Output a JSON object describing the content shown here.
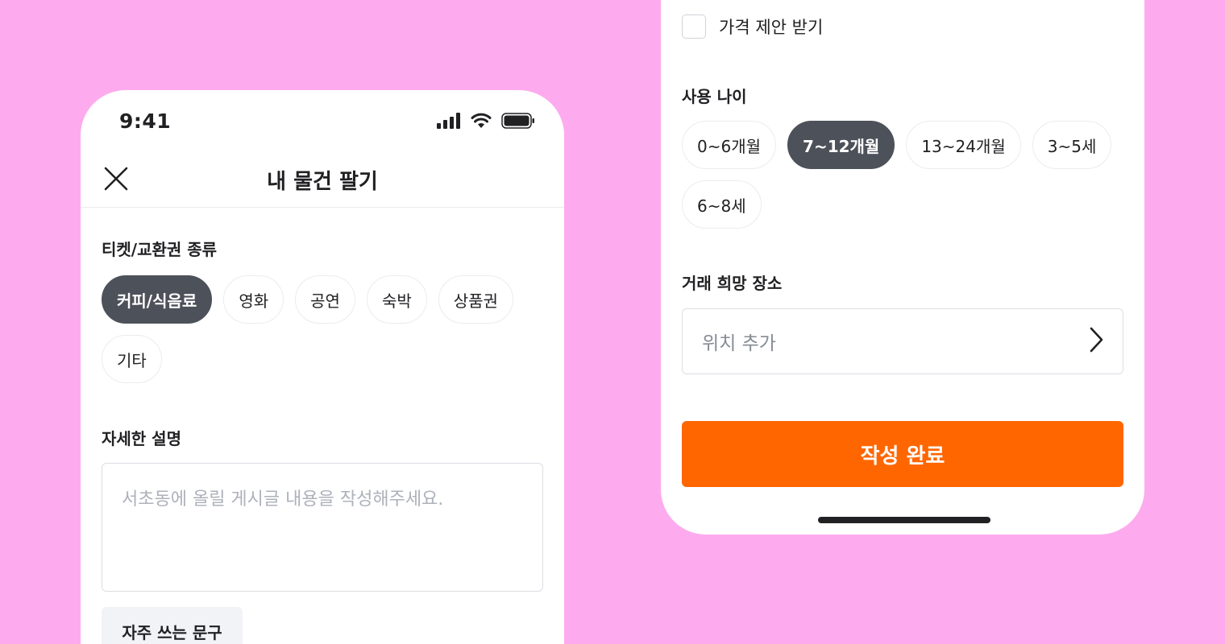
{
  "colors": {
    "background": "#fdabee",
    "accent": "#ff6600",
    "chip_selected": "#4d5159"
  },
  "left_screen": {
    "status_bar": {
      "time": "9:41",
      "icons": [
        "signal-icon",
        "wifi-icon",
        "battery-icon"
      ]
    },
    "header": {
      "title": "내 물건 팔기",
      "close_icon": "close-icon"
    },
    "ticket_type": {
      "label": "티켓/교환권 종류",
      "options": [
        "커피/식음료",
        "영화",
        "공연",
        "숙박",
        "상품권",
        "기타"
      ],
      "selected": "커피/식음료"
    },
    "description": {
      "label": "자세한 설명",
      "placeholder": "서초동에 올릴 게시글 내용을 작성해주세요."
    },
    "phrase_button": "자주 쓰는 문구"
  },
  "right_screen": {
    "price_offer": {
      "label": "가격 제안 받기",
      "checked": false
    },
    "age": {
      "label": "사용 나이",
      "options": [
        "0~6개월",
        "7~12개월",
        "13~24개월",
        "3~5세",
        "6~8세"
      ],
      "selected": "7~12개월"
    },
    "location": {
      "label": "거래 희망 장소",
      "placeholder": "위치 추가",
      "icon": "chevron-right-icon"
    },
    "submit_label": "작성 완료"
  }
}
